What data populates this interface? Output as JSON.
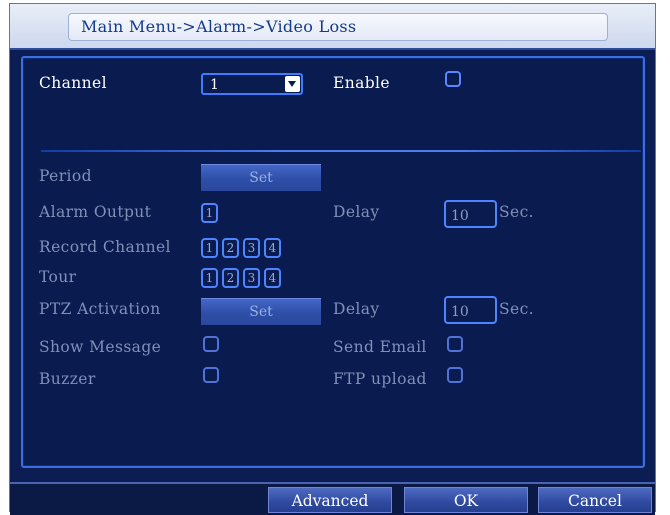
{
  "breadcrumb": "Main Menu->Alarm->Video Loss",
  "channel": {
    "label": "Channel",
    "value": "1"
  },
  "enable": {
    "label": "Enable",
    "checked": false
  },
  "period": {
    "label": "Period",
    "button": "Set"
  },
  "alarm_output": {
    "label": "Alarm Output",
    "boxes": [
      "1"
    ]
  },
  "delay_1": {
    "label": "Delay",
    "value": "10",
    "unit": "Sec."
  },
  "record_channel": {
    "label": "Record Channel",
    "boxes": [
      "1",
      "2",
      "3",
      "4"
    ]
  },
  "tour": {
    "label": "Tour",
    "boxes": [
      "1",
      "2",
      "3",
      "4"
    ]
  },
  "ptz_activation": {
    "label": "PTZ Activation",
    "button": "Set"
  },
  "delay_2": {
    "label": "Delay",
    "value": "10",
    "unit": "Sec."
  },
  "show_message": {
    "label": "Show Message",
    "checked": false
  },
  "send_email": {
    "label": "Send Email",
    "checked": false
  },
  "buzzer": {
    "label": "Buzzer",
    "checked": false
  },
  "ftp_upload": {
    "label": "FTP upload",
    "checked": false
  },
  "buttons": {
    "advanced": "Advanced",
    "ok": "OK",
    "cancel": "Cancel"
  },
  "colors": {
    "background": "#0a1c4f",
    "accent": "#3d7cff",
    "disabled_text": "#8190b8"
  }
}
